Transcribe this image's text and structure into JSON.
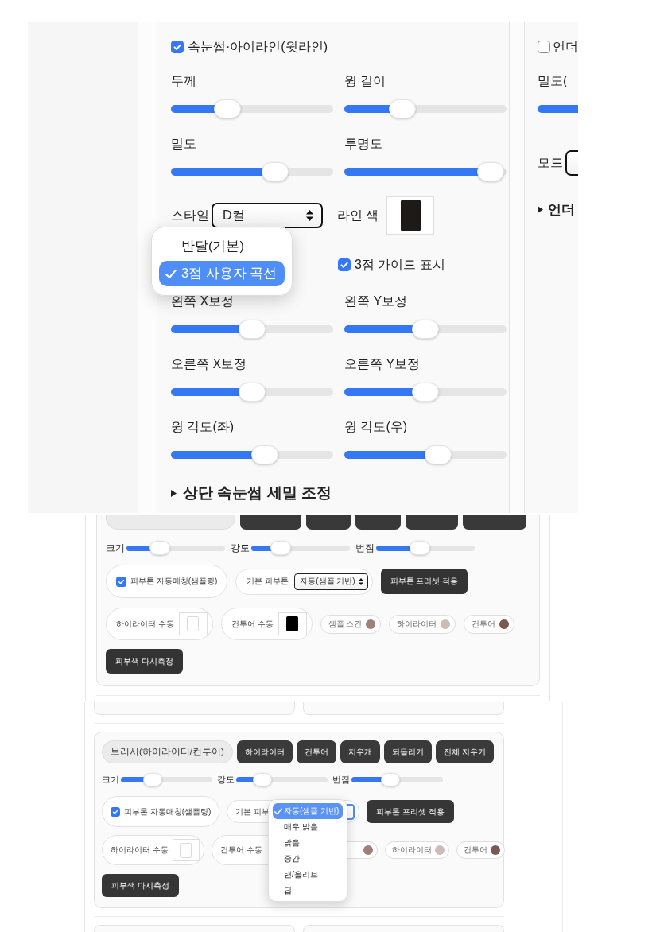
{
  "eyeliner_view": {
    "main_card": {
      "toggle": {
        "label": "속눈썹·아이라인(윗라인)",
        "checked": true
      },
      "rows": [
        {
          "kind": "sliders",
          "sliders": [
            {
              "label": "두께",
              "level": 0.35
            },
            {
              "label": "윙 길이",
              "level": 0.36
            }
          ]
        },
        {
          "kind": "sliders",
          "sliders": [
            {
              "label": "밀도",
              "level": 0.64
            },
            {
              "label": "투명도",
              "level": 0.9
            }
          ]
        },
        {
          "kind": "style",
          "label": "스타일",
          "value": "D컬",
          "color_label": "라인 색",
          "color": "#1e1a17"
        },
        {
          "kind": "curve",
          "guide": {
            "label": "3점 가이드 표시",
            "checked": true
          }
        },
        {
          "kind": "sliders",
          "sliders": [
            {
              "label": "왼쪽 X보정",
              "level": 0.5
            },
            {
              "label": "왼쪽 Y보정",
              "level": 0.5
            }
          ]
        },
        {
          "kind": "sliders",
          "sliders": [
            {
              "label": "오른쪽 X보정",
              "level": 0.5
            },
            {
              "label": "오른쪽 Y보정",
              "level": 0.5
            }
          ]
        },
        {
          "kind": "sliders",
          "sliders": [
            {
              "label": "윙 각도(좌)",
              "level": 0.58
            },
            {
              "label": "윙 각도(우)",
              "level": 0.58
            }
          ]
        }
      ],
      "section": {
        "label": "상단 속눈썹 세밀 조정",
        "expanded": false
      }
    },
    "curve_menu": {
      "options": [
        {
          "label": "반달(기본)",
          "selected": false
        },
        {
          "label": "3점 사용자 곡선",
          "selected": true
        }
      ]
    },
    "side_card": {
      "toggle": {
        "label": "언더",
        "checked": false
      },
      "slider": {
        "label": "밀도(",
        "level": 0.5
      },
      "mode_label": "모드",
      "section": {
        "label": "언더",
        "expanded": false
      }
    }
  },
  "brush_view_scrolled": {
    "cut_off_controls": [
      {
        "kind": "pill"
      },
      {
        "kind": "button"
      },
      {
        "kind": "button"
      },
      {
        "kind": "button"
      },
      {
        "kind": "button"
      },
      {
        "kind": "button"
      }
    ],
    "sliders": [
      {
        "label": "크기",
        "level": 0.34
      },
      {
        "label": "강도",
        "level": 0.3
      },
      {
        "label": "번짐",
        "level": 0.44
      }
    ],
    "auto_match": {
      "label": "피부톤 자동매칭(샘플링)",
      "checked": true
    },
    "base_tone": {
      "label": "기본 피부톤",
      "value": "자동(샘플 기반)"
    },
    "preset_button": "피부톤 프리셋 적용",
    "manual_colors": [
      {
        "label": "하이라이터 수동",
        "color": "#ffffff"
      },
      {
        "label": "컨투어 수동",
        "color": "#000000"
      }
    ],
    "samples": [
      {
        "label": "샘플 스킨",
        "color": "#a07f76"
      },
      {
        "label": "하이라이터",
        "color": "#cbbdb5"
      },
      {
        "label": "컨투어",
        "color": "#7a5a4f"
      }
    ],
    "remeasure_button": "피부색 다시측정"
  },
  "brush_view_menu": {
    "mode": "브러시(하이라이터/컨투어)",
    "tools": [
      "하이라이터",
      "컨투어",
      "지우개",
      "되돌리기",
      "전체 지우기"
    ],
    "sliders": [
      {
        "label": "크기",
        "level": 0.35
      },
      {
        "label": "강도",
        "level": 0.29
      },
      {
        "label": "번짐",
        "level": 0.43
      }
    ],
    "auto_match": {
      "label": "피부톤 자동매칭(샘플링)",
      "checked": true
    },
    "base_tone": {
      "label": "기본 피부"
    },
    "preset_button": "피부톤 프리셋 적용",
    "manual_colors": [
      {
        "label": "하이라이터 수동",
        "color": "#ffffff"
      },
      {
        "label": "컨투어 수동"
      }
    ],
    "samples": [
      {
        "color": "#a07f76"
      },
      {
        "label": "하이라이터",
        "color": "#cbbdb5"
      },
      {
        "label": "컨투어",
        "color": "#7a5a4f"
      }
    ],
    "remeasure_button": "피부색 다시측정",
    "tone_menu": {
      "options": [
        {
          "label": "자동(샘플 기반)",
          "selected": true
        },
        {
          "label": "매우 밝음",
          "selected": false
        },
        {
          "label": "밝음",
          "selected": false
        },
        {
          "label": "중간",
          "selected": false
        },
        {
          "label": "탠/올리브",
          "selected": false
        },
        {
          "label": "딥",
          "selected": false
        }
      ]
    }
  }
}
